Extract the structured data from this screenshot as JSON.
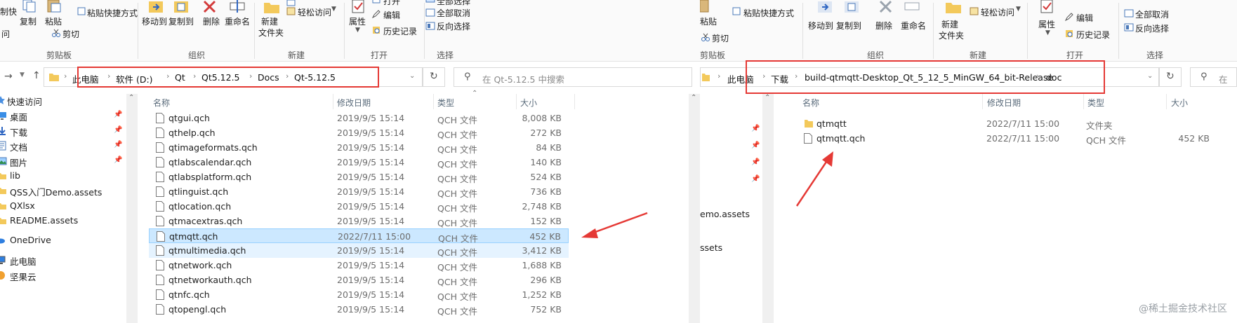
{
  "colors": {
    "folder": "#f3c95b",
    "selection": "#cce8ff",
    "hover": "#e5f3ff",
    "annotation_red": "#e53935"
  },
  "left": {
    "ribbon": {
      "cut_label": "剪切",
      "copy_label": "复制",
      "paste_label": "粘贴",
      "paste_shortcut_label": "粘贴快捷方式",
      "cut_small_label": "剪切",
      "move_to_label": "移动到",
      "copy_to_label": "复制到",
      "delete_label": "删除",
      "rename_label": "重命名",
      "new_folder_label_1": "新建",
      "new_folder_label_2": "文件夹",
      "easy_access_label": "轻松访问",
      "properties_label": "属性",
      "open_label": "打开",
      "edit_label": "编辑",
      "history_label": "历史记录",
      "select_all_label": "全部选择",
      "select_none_label": "全部取消",
      "invert_label": "反向选择",
      "group_clipboard": "剪贴板",
      "group_organize": "组织",
      "group_new": "新建",
      "group_open": "打开",
      "group_select": "选择",
      "cut_edge_1": "制快",
      "cut_edge_2": "问"
    },
    "breadcrumb": [
      "此电脑",
      "软件 (D:)",
      "Qt",
      "Qt5.12.5",
      "Docs",
      "Qt-5.12.5"
    ],
    "search_placeholder": "在 Qt-5.12.5 中搜索",
    "nav": [
      {
        "label": "快速访问",
        "icon": "star-icon",
        "pinned": false
      },
      {
        "label": "桌面",
        "icon": "desktop-icon",
        "pinned": true
      },
      {
        "label": "下载",
        "icon": "download-icon",
        "pinned": true
      },
      {
        "label": "文档",
        "icon": "document-icon",
        "pinned": true
      },
      {
        "label": "图片",
        "icon": "picture-icon",
        "pinned": true
      },
      {
        "label": "lib",
        "icon": "folder-icon",
        "pinned": false
      },
      {
        "label": "QSS入门Demo.assets",
        "icon": "folder-icon",
        "pinned": false
      },
      {
        "label": "QXlsx",
        "icon": "folder-icon",
        "pinned": false
      },
      {
        "label": "README.assets",
        "icon": "folder-icon",
        "pinned": false
      },
      {
        "label": "OneDrive",
        "icon": "cloud-icon",
        "pinned": false
      },
      {
        "label": "此电脑",
        "icon": "computer-icon",
        "pinned": false
      },
      {
        "label": "坚果云",
        "icon": "nut-cloud-icon",
        "pinned": false
      }
    ],
    "columns": {
      "name": "名称",
      "date": "修改日期",
      "type": "类型",
      "size": "大小"
    },
    "files": [
      {
        "name": "qtgui.qch",
        "date": "2019/9/5 15:14",
        "type": "QCH 文件",
        "size": "8,008 KB"
      },
      {
        "name": "qthelp.qch",
        "date": "2019/9/5 15:14",
        "type": "QCH 文件",
        "size": "272 KB"
      },
      {
        "name": "qtimageformats.qch",
        "date": "2019/9/5 15:14",
        "type": "QCH 文件",
        "size": "84 KB"
      },
      {
        "name": "qtlabscalendar.qch",
        "date": "2019/9/5 15:14",
        "type": "QCH 文件",
        "size": "140 KB"
      },
      {
        "name": "qtlabsplatform.qch",
        "date": "2019/9/5 15:14",
        "type": "QCH 文件",
        "size": "524 KB"
      },
      {
        "name": "qtlinguist.qch",
        "date": "2019/9/5 15:14",
        "type": "QCH 文件",
        "size": "736 KB"
      },
      {
        "name": "qtlocation.qch",
        "date": "2019/9/5 15:14",
        "type": "QCH 文件",
        "size": "2,748 KB"
      },
      {
        "name": "qtmacextras.qch",
        "date": "2019/9/5 15:14",
        "type": "QCH 文件",
        "size": "152 KB"
      },
      {
        "name": "qtmqtt.qch",
        "date": "2022/7/11 15:00",
        "type": "QCH 文件",
        "size": "452 KB",
        "state": "selected"
      },
      {
        "name": "qtmultimedia.qch",
        "date": "2019/9/5 15:14",
        "type": "QCH 文件",
        "size": "3,412 KB",
        "state": "hover"
      },
      {
        "name": "qtnetwork.qch",
        "date": "2019/9/5 15:14",
        "type": "QCH 文件",
        "size": "1,688 KB"
      },
      {
        "name": "qtnetworkauth.qch",
        "date": "2019/9/5 15:14",
        "type": "QCH 文件",
        "size": "296 KB"
      },
      {
        "name": "qtnfc.qch",
        "date": "2019/9/5 15:14",
        "type": "QCH 文件",
        "size": "1,252 KB"
      },
      {
        "name": "qtopengl.qch",
        "date": "2019/9/5 15:14",
        "type": "QCH 文件",
        "size": "752 KB"
      }
    ]
  },
  "right": {
    "ribbon": {
      "paste_label": "粘贴",
      "paste_shortcut_label": "粘贴快捷方式",
      "cut_small_label": "剪切",
      "move_to_label": "移动到",
      "copy_to_label": "复制到",
      "delete_label": "删除",
      "rename_label": "重命名",
      "new_folder_label_1": "新建",
      "new_folder_label_2": "文件夹",
      "easy_access_label": "轻松访问",
      "properties_label": "属性",
      "edit_label": "编辑",
      "history_label": "历史记录",
      "select_all_label": "全部取消",
      "invert_label": "反向选择",
      "group_clipboard": "剪贴板",
      "group_organize": "组织",
      "group_new": "新建",
      "group_open": "打开",
      "group_select": "选择"
    },
    "breadcrumb": [
      "此电脑",
      "下载",
      "build-qtmqtt-Desktop_Qt_5_12_5_MinGW_64_bit-Release",
      "doc"
    ],
    "search_placeholder": "在",
    "nav_partial": [
      "emo.assets",
      "ssets"
    ],
    "columns": {
      "name": "名称",
      "date": "修改日期",
      "type": "类型",
      "size": "大小"
    },
    "files": [
      {
        "name": "qtmqtt",
        "date": "2022/7/11 15:00",
        "type": "文件夹",
        "size": "",
        "kind": "folder"
      },
      {
        "name": "qtmqtt.qch",
        "date": "2022/7/11 15:00",
        "type": "QCH 文件",
        "size": "452 KB",
        "kind": "file"
      }
    ]
  },
  "watermark": "@稀土掘金技术社区"
}
